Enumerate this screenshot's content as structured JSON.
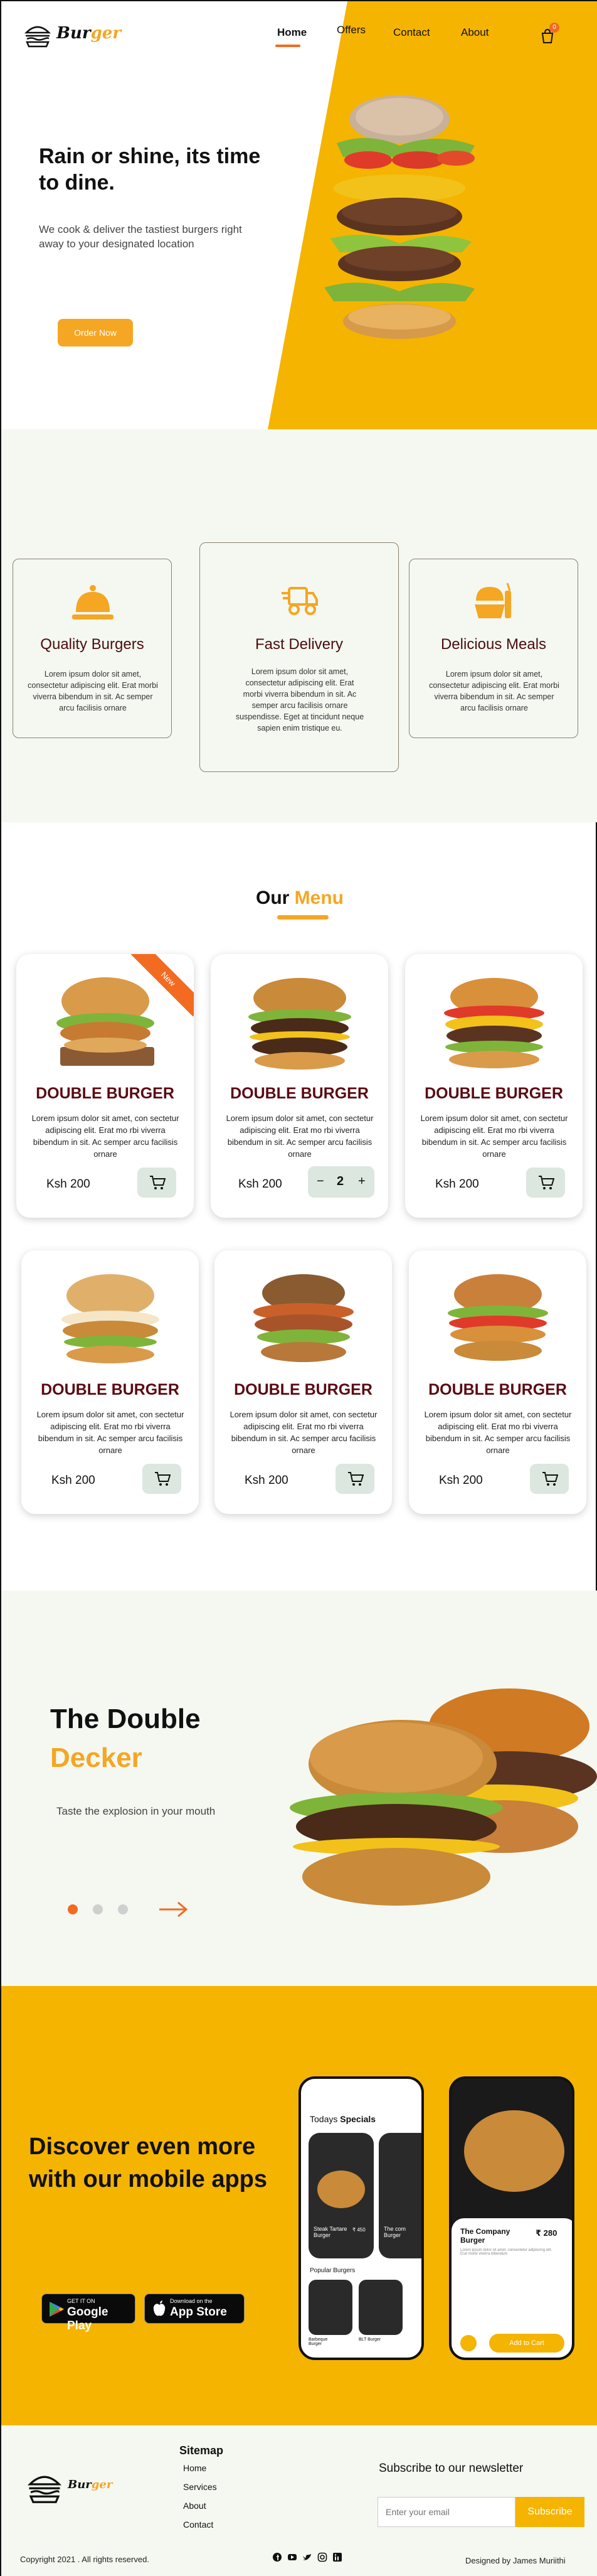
{
  "brand": {
    "name_part1": "Bur",
    "name_part2": "ger",
    "accent": "#F5A623",
    "orange": "#F26B21"
  },
  "nav": {
    "links": [
      "Home",
      "Offers",
      "Contact",
      "About"
    ],
    "active": "Home",
    "cart_count": "0"
  },
  "hero": {
    "title": "Rain or shine, its time to dine.",
    "subtitle": "We cook & deliver the tastiest burgers right away to your designated location",
    "cta": "Order Now",
    "bg_color": "#F5B400"
  },
  "features": [
    {
      "title": "Quality Burgers",
      "text": "Lorem ipsum dolor sit amet, consectetur adipiscing elit. Erat morbi viverra bibendum in sit. Ac semper arcu facilisis ornare",
      "icon": "cloche-icon"
    },
    {
      "title": "Fast Delivery",
      "text": "Lorem ipsum dolor sit amet, consectetur adipiscing elit. Erat morbi viverra bibendum in sit. Ac semper arcu facilisis ornare suspendisse. Eget at tincidunt neque sapien enim tristique eu.",
      "icon": "delivery-truck-icon"
    },
    {
      "title": "Delicious Meals",
      "text": "Lorem ipsum dolor sit amet, consectetur adipiscing elit. Erat morbi viverra bibendum in sit. Ac semper arcu facilisis ornare",
      "icon": "meal-icon"
    }
  ],
  "menu": {
    "title_part1": "Our",
    "title_part2": "Menu",
    "new_badge": "New",
    "items": [
      {
        "name": "DOUBLE BURGER",
        "desc": "Lorem ipsum dolor sit amet, con sectetur adipiscing elit. Erat mo rbi viverra bibendum in sit. Ac semper arcu facilisis ornare",
        "price": "Ksh 200"
      },
      {
        "name": "DOUBLE BURGER",
        "desc": "Lorem ipsum dolor sit amet, con sectetur adipiscing elit. Erat mo rbi viverra bibendum in sit. Ac semper arcu facilisis ornare",
        "price": "Ksh 200",
        "qty": "2",
        "minus": "−",
        "plus": "+"
      },
      {
        "name": "DOUBLE BURGER",
        "desc": "Lorem ipsum dolor sit amet, con sectetur adipiscing elit. Erat mo rbi viverra bibendum in sit. Ac semper arcu facilisis ornare",
        "price": "Ksh 200"
      },
      {
        "name": "DOUBLE BURGER",
        "desc": "Lorem ipsum dolor sit amet, con sectetur adipiscing elit. Erat mo rbi viverra bibendum in sit. Ac semper arcu facilisis ornare",
        "price": "Ksh 200"
      },
      {
        "name": "DOUBLE BURGER",
        "desc": "Lorem ipsum dolor sit amet, con sectetur adipiscing elit. Erat mo rbi viverra bibendum in sit. Ac semper arcu facilisis ornare",
        "price": "Ksh 200"
      },
      {
        "name": "DOUBLE BURGER",
        "desc": "Lorem ipsum dolor sit amet, con sectetur adipiscing elit. Erat mo rbi viverra bibendum in sit. Ac semper arcu facilisis ornare",
        "price": "Ksh 200"
      }
    ]
  },
  "double_decker": {
    "title1": "The Double",
    "title2": "Decker",
    "subtitle": "Taste the explosion in your mouth",
    "active_dot": 1
  },
  "app": {
    "title": "Discover even more with our mobile apps",
    "google_small": "GET IT ON",
    "google_big": "Google Play",
    "apple_small": "Download on the",
    "apple_big": "App Store",
    "phone1": {
      "heading_light": "Todays",
      "heading_bold": "Specials",
      "card1": "Steak Tartare Burger",
      "card1_price": "₹ 450",
      "card2": "The com Burger",
      "popular": "Popular Burgers",
      "p1": "Barbeque Burger",
      "p2": "BLT Burger"
    },
    "phone2": {
      "title": "The Company Burger",
      "price": "₹ 280",
      "add": "Add to Cart",
      "desc": "Lorem ipsum dolor sit amet, consectetur adipiscing elit. Erat morbi viverra bibendum"
    }
  },
  "footer": {
    "sitemap_title": "Sitemap",
    "links": [
      "Home",
      "Services",
      "About",
      "Contact"
    ],
    "newsletter_title": "Subscribe to our newsletter",
    "email_placeholder": "Enter your email",
    "subscribe": "Subscribe",
    "copyright": "Copyright 2021 . All rights reserved.",
    "designer": "Designed by James Muriithi"
  }
}
